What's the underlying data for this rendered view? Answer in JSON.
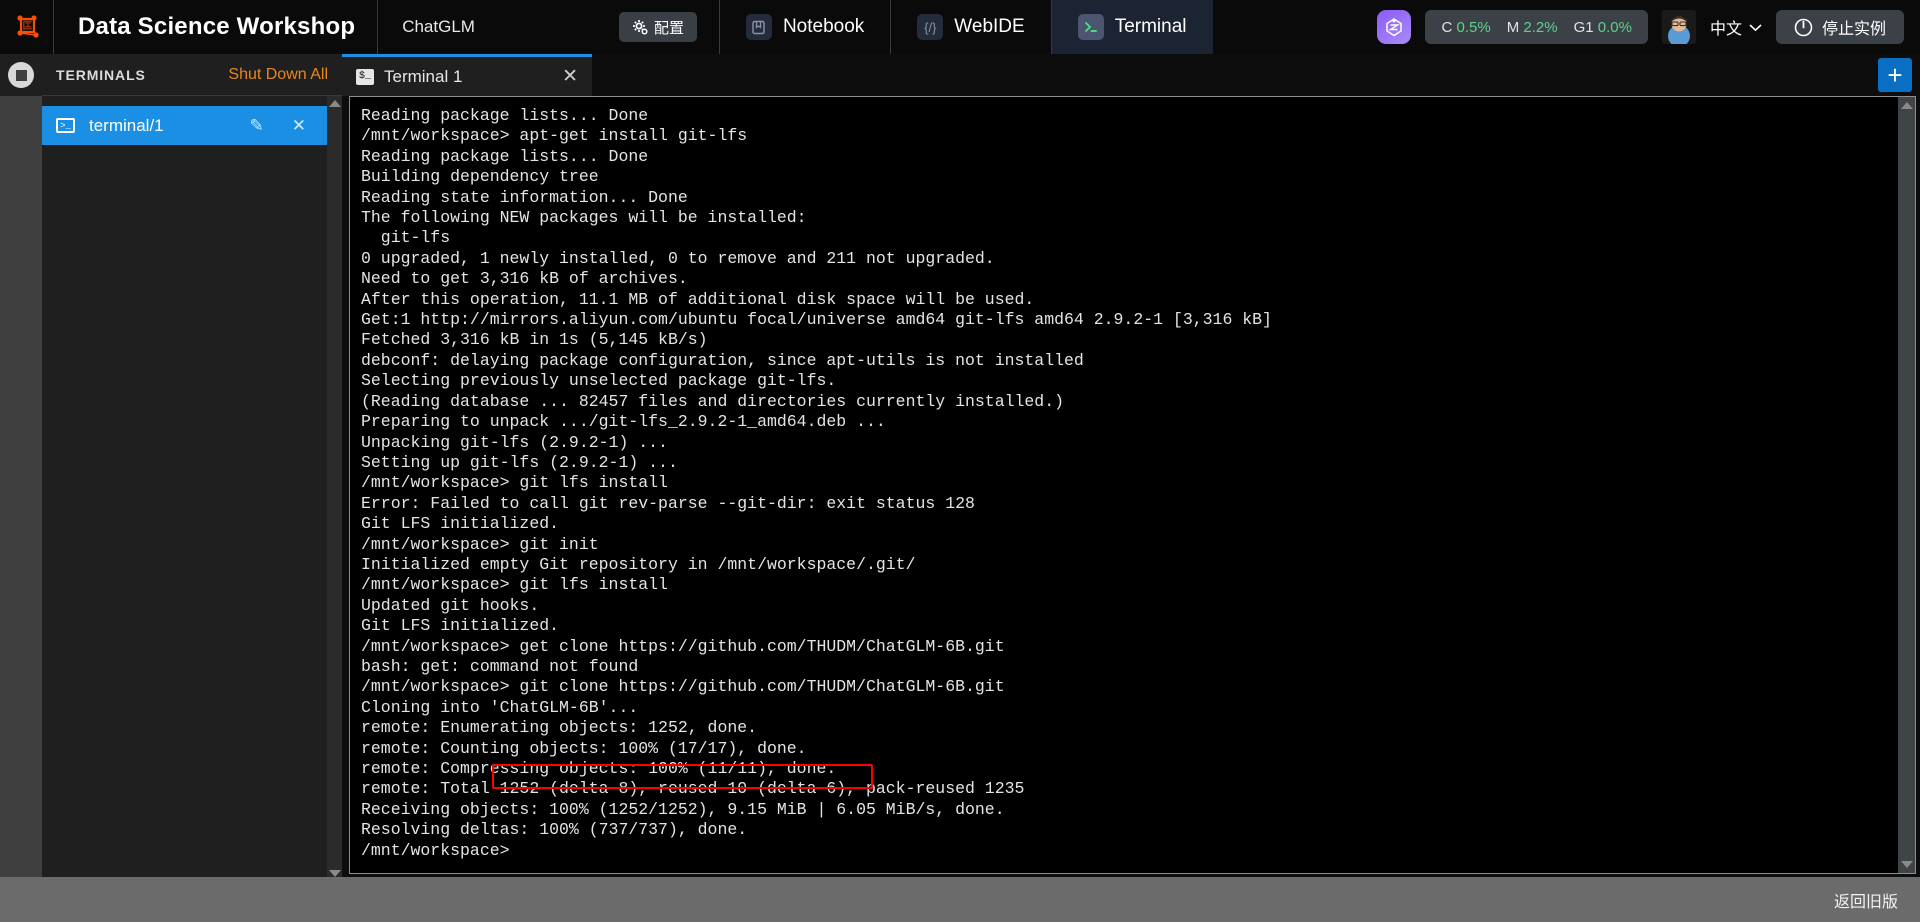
{
  "header": {
    "logo_icon": "workflow-graph-icon",
    "app_title": "Data Science Workshop",
    "project_name": "ChatGLM",
    "config_button": {
      "label": "配置",
      "icon": "gear-icon"
    },
    "nav_items": [
      {
        "label": "Notebook",
        "icon": "notebook-icon",
        "active": false
      },
      {
        "label": "WebIDE",
        "icon": "code-brackets-icon",
        "active": false
      },
      {
        "label": "Terminal",
        "icon": "terminal-prompt-icon",
        "active": true
      }
    ],
    "glm_badge_icon": "glm-logo-icon",
    "metrics": [
      {
        "key": "C",
        "value": "0.5%"
      },
      {
        "key": "M",
        "value": "2.2%"
      },
      {
        "key": "G1",
        "value": "0.0%"
      }
    ],
    "avatar_icon": "user-avatar",
    "language": {
      "label": "中文",
      "chevron": "chevron-down-icon"
    },
    "stop_instance": {
      "label": "停止实例",
      "icon": "power-icon"
    },
    "accent_orange": "#e8871e",
    "accent_blue": "#1a8fe3",
    "metric_value_color": "#5fd18a"
  },
  "activity_bar": {
    "stop_icon": "stop-record-icon"
  },
  "sidebar": {
    "title": "TERMINALS",
    "shut_down_all": "Shut Down All",
    "terminals": [
      {
        "name": "terminal/1",
        "icon": "terminal-prompt-icon",
        "edit_icon": "pencil-icon",
        "close_icon": "close-icon"
      }
    ],
    "scroll_up_icon": "arrow-up-icon",
    "scroll_down_icon": "arrow-down-icon"
  },
  "main": {
    "tabs": [
      {
        "label": "Terminal 1",
        "icon": "shell-prompt-icon",
        "close_icon": "close-icon",
        "active": true
      }
    ],
    "add_tab_label": "+",
    "scroll_up_icon": "arrow-up-icon",
    "scroll_down_icon": "arrow-down-icon",
    "terminal_lines": [
      "Reading package lists... Done",
      "/mnt/workspace> apt-get install git-lfs",
      "Reading package lists... Done",
      "Building dependency tree",
      "Reading state information... Done",
      "The following NEW packages will be installed:",
      "  git-lfs",
      "0 upgraded, 1 newly installed, 0 to remove and 211 not upgraded.",
      "Need to get 3,316 kB of archives.",
      "After this operation, 11.1 MB of additional disk space will be used.",
      "Get:1 http://mirrors.aliyun.com/ubuntu focal/universe amd64 git-lfs amd64 2.9.2-1 [3,316 kB]",
      "Fetched 3,316 kB in 1s (5,145 kB/s)",
      "debconf: delaying package configuration, since apt-utils is not installed",
      "Selecting previously unselected package git-lfs.",
      "(Reading database ... 82457 files and directories currently installed.)",
      "Preparing to unpack .../git-lfs_2.9.2-1_amd64.deb ...",
      "Unpacking git-lfs (2.9.2-1) ...",
      "Setting up git-lfs (2.9.2-1) ...",
      "/mnt/workspace> git lfs install",
      "Error: Failed to call git rev-parse --git-dir: exit status 128",
      "Git LFS initialized.",
      "/mnt/workspace> git init",
      "Initialized empty Git repository in /mnt/workspace/.git/",
      "/mnt/workspace> git lfs install",
      "Updated git hooks.",
      "Git LFS initialized.",
      "/mnt/workspace> get clone https://github.com/THUDM/ChatGLM-6B.git",
      "bash: get: command not found",
      "/mnt/workspace> git clone https://github.com/THUDM/ChatGLM-6B.git",
      "Cloning into 'ChatGLM-6B'...",
      "remote: Enumerating objects: 1252, done.",
      "remote: Counting objects: 100% (17/17), done.",
      "remote: Compressing objects: 100% (11/11), done.",
      "remote: Total 1252 (delta 8), reused 10 (delta 6), pack-reused 1235",
      "Receiving objects: 100% (1252/1252), 9.15 MiB | 6.05 MiB/s, done.",
      "Resolving deltas: 100% (737/737), done.",
      "/mnt/workspace>"
    ],
    "highlight": {
      "text": "git clone https://github.com/THUDM/ChatGLM-6B.git",
      "color": "#ff0000"
    }
  },
  "footer": {
    "link": "返回旧版"
  }
}
